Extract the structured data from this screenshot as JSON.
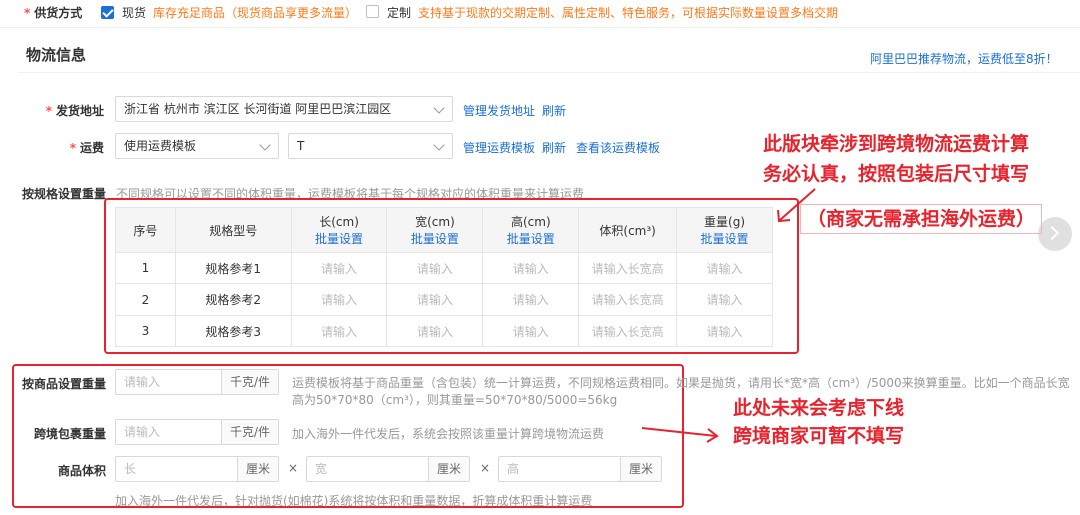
{
  "supply": {
    "label": "供货方式",
    "option_stock": "现货",
    "stock_note": "库存充足商品（现货商品享更多流量）",
    "option_custom": "定制",
    "custom_note": "支持基于现款的交期定制、属性定制、特色服务，可根据实际数量设置多档交期"
  },
  "logistics": {
    "title": "物流信息",
    "promo_link": "阿里巴巴推荐物流，运费低至8折！",
    "address_label": "发货地址",
    "address_value": "浙江省 杭州市 滨江区 长河街道 阿里巴巴滨江园区",
    "manage_address": "管理发货地址",
    "refresh": "刷新",
    "freight_label": "运费",
    "freight_mode": "使用运费模板",
    "freight_template": "T",
    "manage_freight": "管理运费模板",
    "view_template": "查看该运费模板"
  },
  "spec_weight": {
    "label": "按规格设置重量",
    "hint": "不同规格可以设置不同的体积重量，运费模板将基于每个规格对应的体积重量来计算运费",
    "headers": {
      "index": "序号",
      "model": "规格型号",
      "length": "长(cm)",
      "width": "宽(cm)",
      "height": "高(cm)",
      "volume": "体积(cm³)",
      "weight": "重量(g)",
      "batch": "批量设置"
    },
    "rows": [
      {
        "index": "1",
        "model": "规格参考1",
        "length": "请输入",
        "width": "请输入",
        "height": "请输入",
        "volume": "请输入长宽高",
        "weight": "请输入"
      },
      {
        "index": "2",
        "model": "规格参考2",
        "length": "请输入",
        "width": "请输入",
        "height": "请输入",
        "volume": "请输入长宽高",
        "weight": "请输入"
      },
      {
        "index": "3",
        "model": "规格参考3",
        "length": "请输入",
        "width": "请输入",
        "height": "请输入",
        "volume": "请输入长宽高",
        "weight": "请输入"
      }
    ]
  },
  "product_weight": {
    "label": "按商品设置重量",
    "placeholder": "请输入",
    "unit": "千克/件",
    "hint_line1": "运费模板将基于商品重量（含包装）统一计算运费，不同规格运费相同。如果是抛货，请用长*宽*高（cm³）/5000来换算重量。比如一个商品长宽",
    "hint_line2": "高为50*70*80（cm³），则其重量=50*70*80/5000=56kg"
  },
  "parcel_weight": {
    "label": "跨境包裹重量",
    "placeholder": "请输入",
    "unit": "千克/件",
    "hint": "加入海外一件代发后，系统会按照该重量计算跨境物流运费"
  },
  "product_volume": {
    "label": "商品体积",
    "length_ph": "长",
    "width_ph": "宽",
    "height_ph": "高",
    "unit": "厘米",
    "times": "×",
    "hint": "加入海外一件代发后，针对抛货(如棉花)系统将按体积和重量数据，折算成体积重计算运费"
  },
  "annotations": {
    "top_line1": "此版块牵涉到跨境物流运费计算",
    "top_line2": "务必认真，按照包装后尺寸填写",
    "top_line3": "（商家无需承担海外运费）",
    "bottom_line1": "此处未来会考虑下线",
    "bottom_line2": "跨境商家可暂不填写"
  },
  "colors": {
    "accent": "#1a6fd8",
    "highlight": "#ff7a1a",
    "annotation": "#e8232d"
  }
}
